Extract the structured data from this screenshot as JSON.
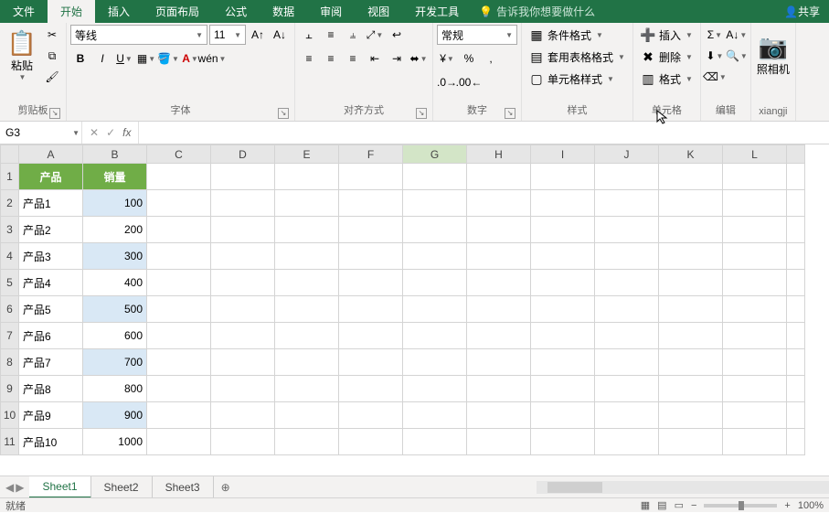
{
  "tabs": {
    "file": "文件",
    "home": "开始",
    "insert": "插入",
    "layout": "页面布局",
    "formula": "公式",
    "data": "数据",
    "review": "审阅",
    "view": "视图",
    "dev": "开发工具"
  },
  "tellme": "告诉我你想要做什么",
  "share": "共享",
  "ribbon": {
    "font_name": "等线",
    "font_size": "11",
    "clipboard_label": "剪贴板",
    "paste": "粘贴",
    "font_label": "字体",
    "align_label": "对齐方式",
    "number_label": "数字",
    "styles_label": "样式",
    "cells_label": "单元格",
    "editing_label": "编辑",
    "camera_label": "xiangji",
    "number_format": "常规",
    "cond_fmt": "条件格式",
    "tbl_fmt": "套用表格格式",
    "cell_style": "单元格样式",
    "ins": "插入",
    "del": "删除",
    "fmt": "格式",
    "camera": "照相机"
  },
  "fbar": {
    "name": "G3",
    "formula": ""
  },
  "columns": [
    "A",
    "B",
    "C",
    "D",
    "E",
    "F",
    "G",
    "H",
    "I",
    "J",
    "K",
    "L"
  ],
  "headers": {
    "a": "产品",
    "b": "销量"
  },
  "rows": [
    {
      "a": "产品1",
      "b": "100"
    },
    {
      "a": "产品2",
      "b": "200"
    },
    {
      "a": "产品3",
      "b": "300"
    },
    {
      "a": "产品4",
      "b": "400"
    },
    {
      "a": "产品5",
      "b": "500"
    },
    {
      "a": "产品6",
      "b": "600"
    },
    {
      "a": "产品7",
      "b": "700"
    },
    {
      "a": "产品8",
      "b": "800"
    },
    {
      "a": "产品9",
      "b": "900"
    },
    {
      "a": "产品10",
      "b": "1000"
    }
  ],
  "sheets": [
    "Sheet1",
    "Sheet2",
    "Sheet3"
  ],
  "status": {
    "ready": "就绪",
    "zoom": "100%"
  }
}
